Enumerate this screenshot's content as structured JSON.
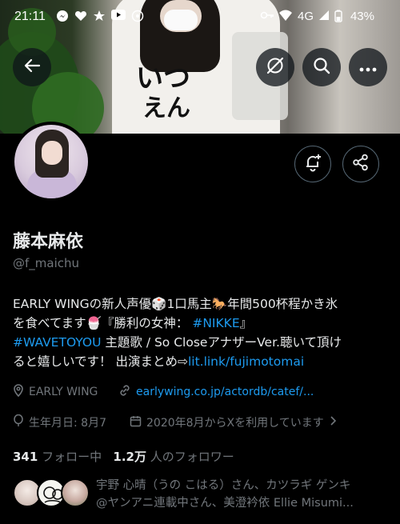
{
  "status_bar": {
    "time": "21:11",
    "network": "4G",
    "battery": "43%",
    "icons": [
      "messenger-icon",
      "heart-icon",
      "star-icon",
      "youtube-icon",
      "sync-icon",
      "key-icon",
      "wifi-icon",
      "signal-icon",
      "battery-icon"
    ]
  },
  "banner": {
    "kana_1": "いつ",
    "kana_2": "えん"
  },
  "nav": {
    "back_icon": "back-arrow-icon",
    "grok_icon": "grok-icon",
    "search_icon": "search-icon",
    "more_icon": "more-icon"
  },
  "profile": {
    "name": "藤本麻依",
    "handle": "@f_maichu",
    "bio": {
      "line1": "EARLY WINGの新人声優🎲1口馬主🐎年間500杯程かき氷",
      "line2_a": "を食べてます🍧『勝利の女神：",
      "hashtag1": "#NIKKE",
      "line2_b": "』",
      "hashtag2": "#WAVETOYOU",
      "line3_a": " 主題歌 / So CloseアナザーVer.聴いて頂け",
      "line4_a": "ると嬉しいです！ 出演まとめ⇨",
      "link": "lit.link/fujimotomai"
    },
    "location": "EARLY WING",
    "website": "earlywing.co.jp/actordb/catef/...",
    "birthday": "生年月日: 8月7",
    "joined": "2020年8月からXを利用しています",
    "following_count": "341",
    "following_label": "フォロー中",
    "followers_count": "1.2万",
    "followers_label": "人のフォロワー",
    "followed_by_line1": "宇野 心晴（うの こはる）さん、カツラギ ゲンキ",
    "followed_by_line2": "@ヤンアニ連載中さん、美澄衿依 Ellie Misumi..."
  },
  "colors": {
    "background": "#000000",
    "text": "#e7e9ea",
    "secondary": "#71767b",
    "link": "#1d9bf0",
    "border": "#536471"
  }
}
